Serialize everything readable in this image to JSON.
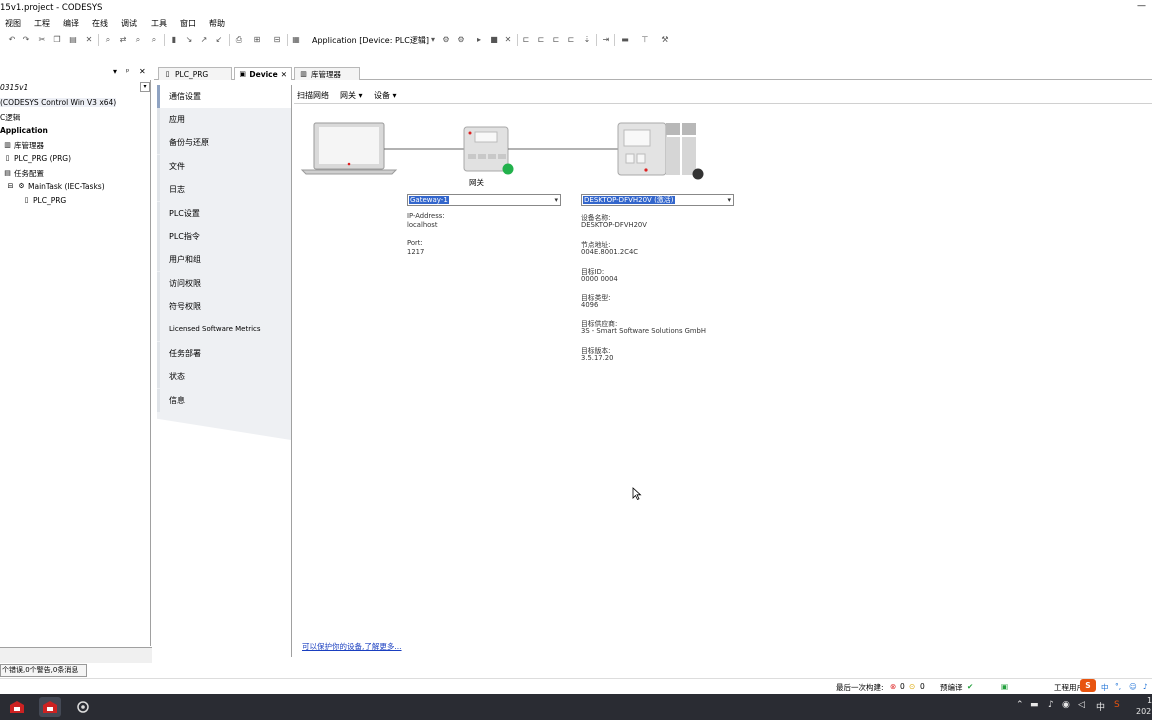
{
  "window": {
    "title": "15v1.project - CODESYS",
    "close_glyph": "—"
  },
  "menu": [
    "视图",
    "工程",
    "编译",
    "在线",
    "调试",
    "工具",
    "窗口",
    "帮助"
  ],
  "toolbar": {
    "application_label": "Application [Device: PLC逻辑]"
  },
  "devices_panel": {
    "pin": "▾",
    "dock": "ᵖ",
    "close": "✕",
    "tree": [
      {
        "label": "0315v1",
        "italic": true
      },
      {
        "label": "(CODESYS Control Win V3 x64)"
      },
      {
        "label": "C逻辑"
      },
      {
        "label": "Application",
        "bold": true
      },
      {
        "label": "库管理器"
      },
      {
        "label": "PLC_PRG (PRG)"
      },
      {
        "label": "任务配置"
      },
      {
        "label": "MainTask (IEC-Tasks)"
      },
      {
        "label": "PLC_PRG"
      }
    ]
  },
  "tabs": [
    {
      "label": "PLC_PRG",
      "active": false
    },
    {
      "label": "Device",
      "active": true
    },
    {
      "label": "库管理器",
      "active": false
    }
  ],
  "nav": [
    {
      "label": "通信设置",
      "active": true
    },
    {
      "label": "应用"
    },
    {
      "label": "备份与还原"
    },
    {
      "label": "文件"
    },
    {
      "label": "日志"
    },
    {
      "label": "PLC设置"
    },
    {
      "label": "PLC指令"
    },
    {
      "label": "用户和组"
    },
    {
      "label": "访问权限"
    },
    {
      "label": "符号权限"
    },
    {
      "label": "Licensed Software Metrics"
    },
    {
      "label": "任务部署"
    },
    {
      "label": "状态"
    },
    {
      "label": "信息"
    }
  ],
  "comm": {
    "toolbar": {
      "scan": "扫描网络",
      "gateway": "网关 ▾",
      "device": "设备 ▾"
    },
    "gateway": {
      "caption": "网关",
      "combo": "Gateway-1",
      "ip_label": "IP-Address:",
      "ip": "localhost",
      "port_label": "Port:",
      "port": "1217"
    },
    "device": {
      "combo": "DESKTOP-DFVH20V (激活)",
      "fields": [
        {
          "label": "设备名称:",
          "value": "DESKTOP-DFVH20V"
        },
        {
          "label": "节点地址:",
          "value": "004E.8001.2C4C"
        },
        {
          "label": "目标ID:",
          "value": "0000 0004"
        },
        {
          "label": "目标类型:",
          "value": "4096"
        },
        {
          "label": "目标供应商:",
          "value": "3S - Smart Software Solutions GmbH"
        },
        {
          "label": "目标版本:",
          "value": "3.5.17.20"
        }
      ]
    },
    "footer_link": "可以保护你的设备,了解更多..."
  },
  "messages_tab": "个错误,0个警告,0条消息",
  "status": {
    "last_build": "最后一次构建:",
    "errors": "0",
    "warnings": "0",
    "precompile": "预编译",
    "project_user": "工程用户"
  },
  "taskbar": {
    "clock": "1",
    "date": "202"
  },
  "colors": {
    "gateway_status": "#22b14c",
    "device_status": "#333333",
    "selection": "#3366cc",
    "link": "#1a3fc0"
  }
}
